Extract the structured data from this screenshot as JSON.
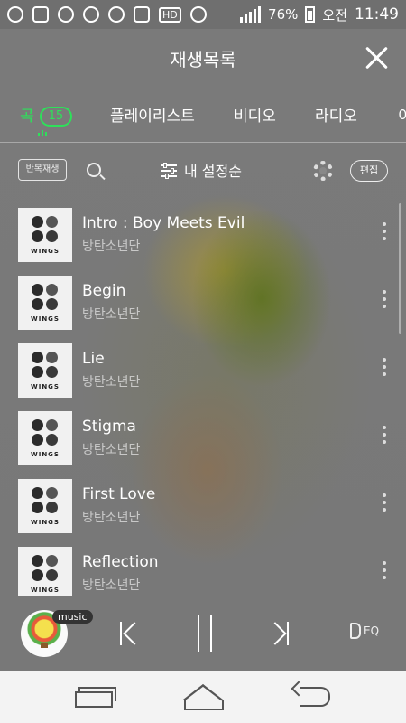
{
  "status_bar": {
    "battery": "76%",
    "ampm": "오전",
    "time": "11:49",
    "hd_label": "HD"
  },
  "header": {
    "title": "재생목록"
  },
  "tabs": [
    {
      "label": "곡",
      "count": "15",
      "active": true
    },
    {
      "label": "플레이리스트",
      "active": false
    },
    {
      "label": "비디오",
      "active": false
    },
    {
      "label": "라디오",
      "active": false
    },
    {
      "label": "이",
      "active": false
    }
  ],
  "toolbar": {
    "repeat_label": "반복재생",
    "sort_label": "내 설정순",
    "edit_label": "편집"
  },
  "album_cover_text": "WINGS",
  "songs": [
    {
      "title": "Intro : Boy Meets Evil",
      "artist": "방탄소년단"
    },
    {
      "title": "Begin",
      "artist": "방탄소년단"
    },
    {
      "title": "Lie",
      "artist": "방탄소년단"
    },
    {
      "title": "Stigma",
      "artist": "방탄소년단"
    },
    {
      "title": "First Love",
      "artist": "방탄소년단"
    },
    {
      "title": "Reflection",
      "artist": "방탄소년단"
    }
  ],
  "player": {
    "badge": "music",
    "eq_label": "EQ",
    "state": "playing"
  },
  "colors": {
    "accent": "#2ee05a",
    "nav_bg": "#f3f3f3"
  }
}
